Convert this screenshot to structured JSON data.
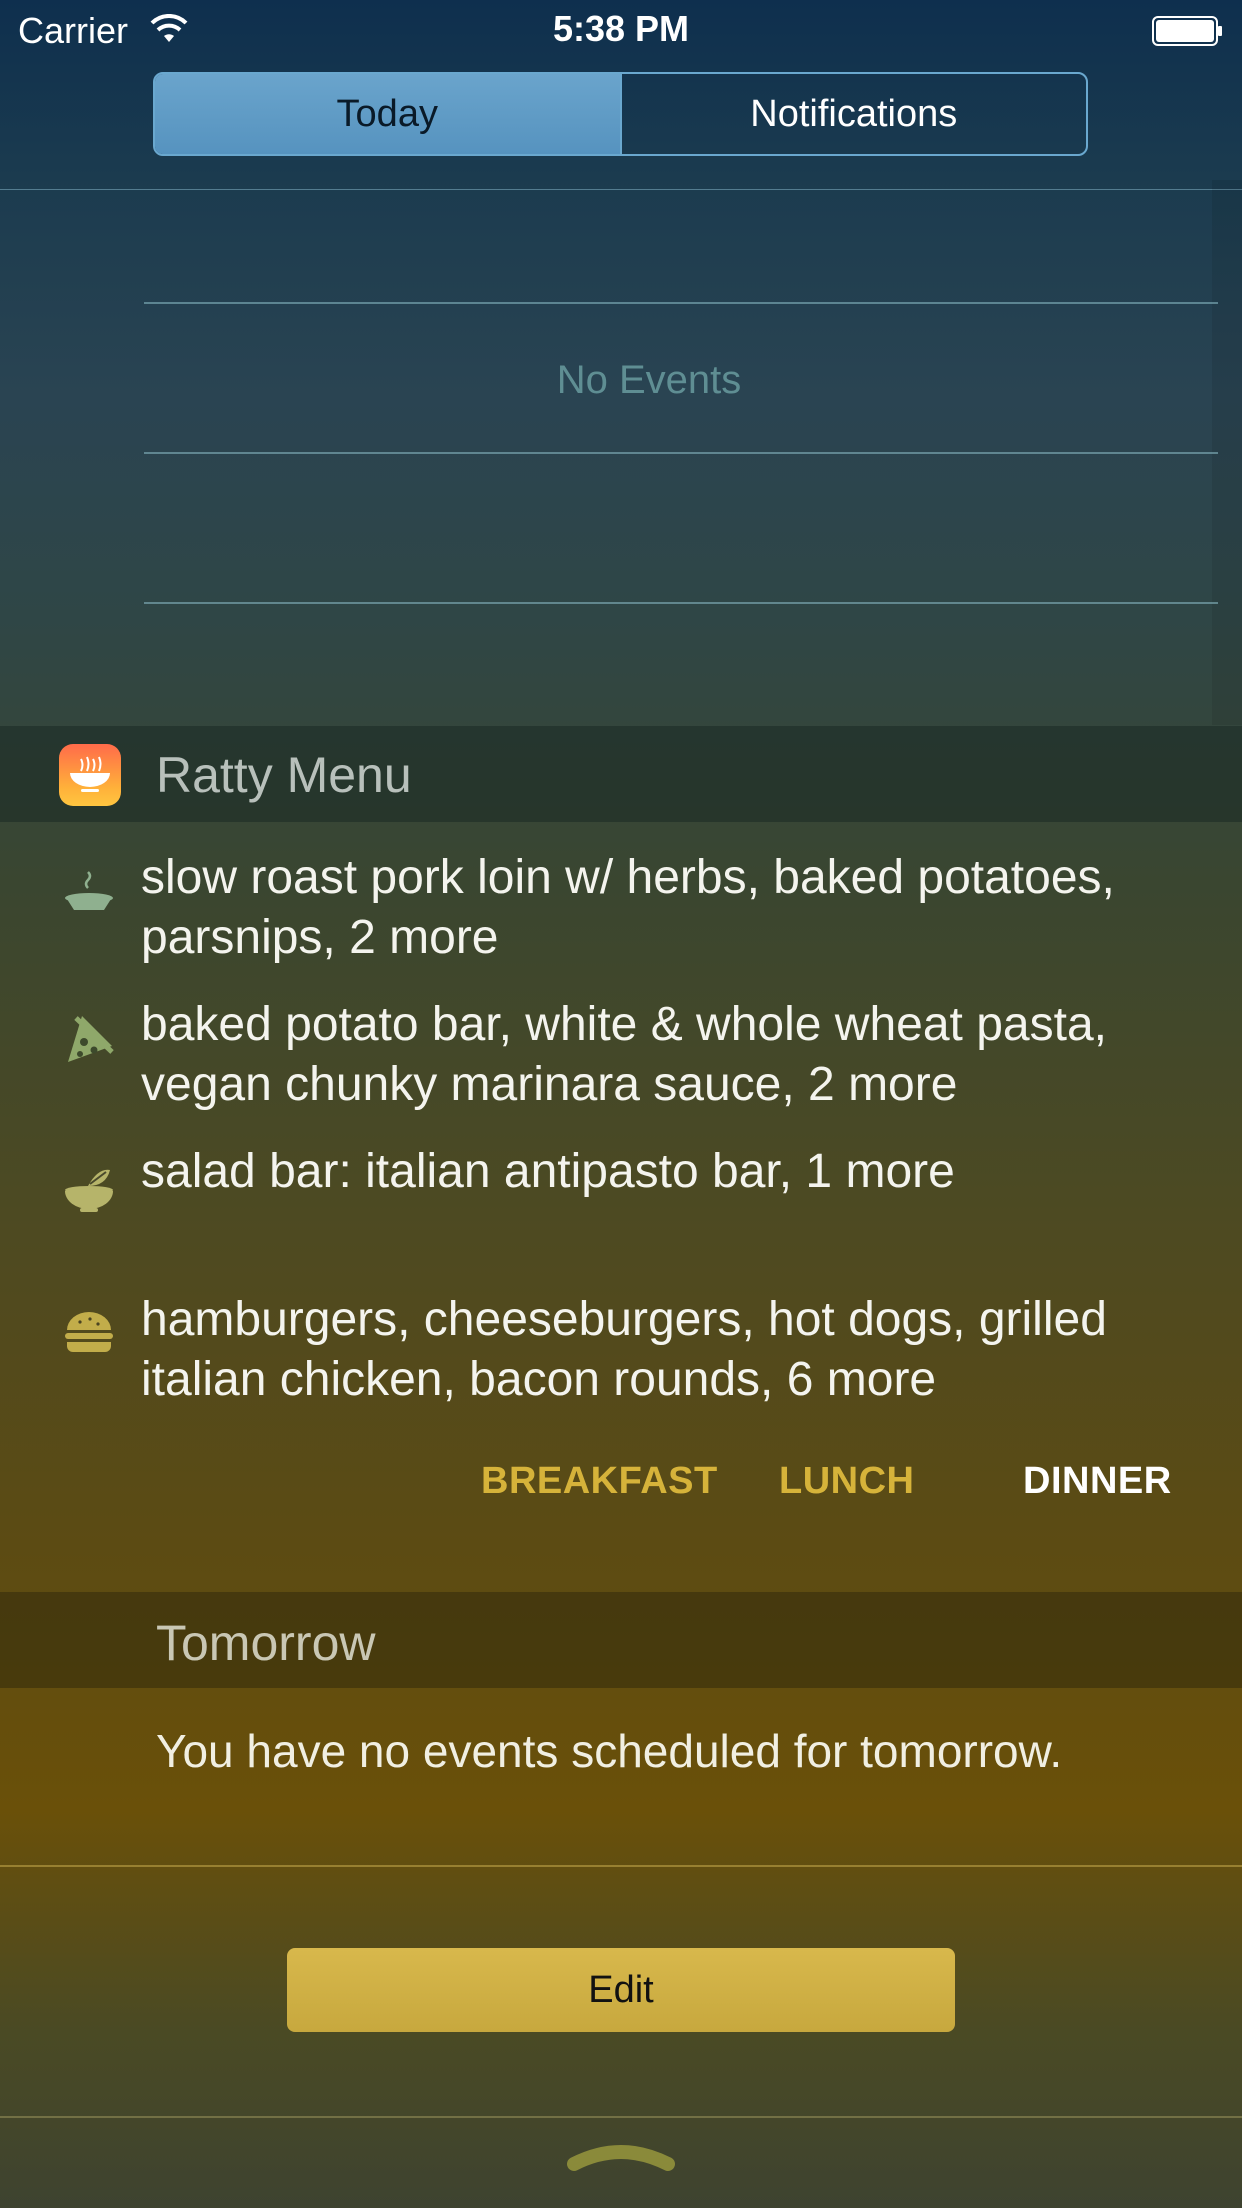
{
  "status_bar": {
    "carrier": "Carrier",
    "time": "5:38 PM",
    "wifi_icon": "wifi-icon",
    "battery_icon": "battery-icon"
  },
  "segmented_control": {
    "tabs": [
      {
        "label": "Today",
        "selected": true
      },
      {
        "label": "Notifications",
        "selected": false
      }
    ]
  },
  "calendar": {
    "empty_text": "No Events"
  },
  "ratty_menu": {
    "title": "Ratty Menu",
    "app_icon": "ratty-app-icon",
    "items": [
      {
        "icon": "pie-icon",
        "text": "slow roast pork loin w/ herbs, baked potatoes, parsnips, 2 more"
      },
      {
        "icon": "pizza-icon",
        "text": "baked potato bar, white & whole wheat pasta, vegan chunky marinara sauce, 2 more"
      },
      {
        "icon": "salad-bowl-icon",
        "text": "salad bar: italian antipasto bar, 1 more"
      },
      {
        "icon": "burger-icon",
        "text": "hamburgers, cheeseburgers, hot dogs, grilled italian chicken, bacon rounds, 6 more"
      }
    ],
    "meals": [
      {
        "label": "BREAKFAST",
        "active": false
      },
      {
        "label": "LUNCH",
        "active": false
      },
      {
        "label": "DINNER",
        "active": true
      }
    ]
  },
  "tomorrow": {
    "title": "Tomorrow",
    "text": "You have no events scheduled for tomorrow."
  },
  "edit": {
    "label": "Edit"
  },
  "bottom": {
    "grabber_icon": "chevron-up-grabber-icon"
  },
  "colors": {
    "accent_gold": "#d6b33a",
    "segment_selected": "#5693bf",
    "edit_button": "#cfae44"
  }
}
